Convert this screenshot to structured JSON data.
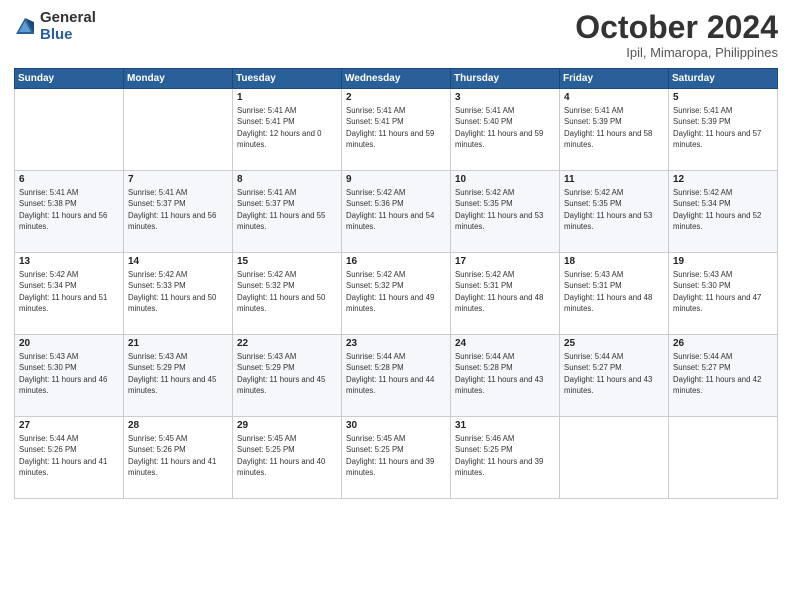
{
  "header": {
    "logo_general": "General",
    "logo_blue": "Blue",
    "title": "October 2024",
    "location": "Ipil, Mimaropa, Philippines"
  },
  "weekdays": [
    "Sunday",
    "Monday",
    "Tuesday",
    "Wednesday",
    "Thursday",
    "Friday",
    "Saturday"
  ],
  "weeks": [
    [
      {
        "day": "",
        "sunrise": "",
        "sunset": "",
        "daylight": ""
      },
      {
        "day": "",
        "sunrise": "",
        "sunset": "",
        "daylight": ""
      },
      {
        "day": "1",
        "sunrise": "Sunrise: 5:41 AM",
        "sunset": "Sunset: 5:41 PM",
        "daylight": "Daylight: 12 hours and 0 minutes."
      },
      {
        "day": "2",
        "sunrise": "Sunrise: 5:41 AM",
        "sunset": "Sunset: 5:41 PM",
        "daylight": "Daylight: 11 hours and 59 minutes."
      },
      {
        "day": "3",
        "sunrise": "Sunrise: 5:41 AM",
        "sunset": "Sunset: 5:40 PM",
        "daylight": "Daylight: 11 hours and 59 minutes."
      },
      {
        "day": "4",
        "sunrise": "Sunrise: 5:41 AM",
        "sunset": "Sunset: 5:39 PM",
        "daylight": "Daylight: 11 hours and 58 minutes."
      },
      {
        "day": "5",
        "sunrise": "Sunrise: 5:41 AM",
        "sunset": "Sunset: 5:39 PM",
        "daylight": "Daylight: 11 hours and 57 minutes."
      }
    ],
    [
      {
        "day": "6",
        "sunrise": "Sunrise: 5:41 AM",
        "sunset": "Sunset: 5:38 PM",
        "daylight": "Daylight: 11 hours and 56 minutes."
      },
      {
        "day": "7",
        "sunrise": "Sunrise: 5:41 AM",
        "sunset": "Sunset: 5:37 PM",
        "daylight": "Daylight: 11 hours and 56 minutes."
      },
      {
        "day": "8",
        "sunrise": "Sunrise: 5:41 AM",
        "sunset": "Sunset: 5:37 PM",
        "daylight": "Daylight: 11 hours and 55 minutes."
      },
      {
        "day": "9",
        "sunrise": "Sunrise: 5:42 AM",
        "sunset": "Sunset: 5:36 PM",
        "daylight": "Daylight: 11 hours and 54 minutes."
      },
      {
        "day": "10",
        "sunrise": "Sunrise: 5:42 AM",
        "sunset": "Sunset: 5:35 PM",
        "daylight": "Daylight: 11 hours and 53 minutes."
      },
      {
        "day": "11",
        "sunrise": "Sunrise: 5:42 AM",
        "sunset": "Sunset: 5:35 PM",
        "daylight": "Daylight: 11 hours and 53 minutes."
      },
      {
        "day": "12",
        "sunrise": "Sunrise: 5:42 AM",
        "sunset": "Sunset: 5:34 PM",
        "daylight": "Daylight: 11 hours and 52 minutes."
      }
    ],
    [
      {
        "day": "13",
        "sunrise": "Sunrise: 5:42 AM",
        "sunset": "Sunset: 5:34 PM",
        "daylight": "Daylight: 11 hours and 51 minutes."
      },
      {
        "day": "14",
        "sunrise": "Sunrise: 5:42 AM",
        "sunset": "Sunset: 5:33 PM",
        "daylight": "Daylight: 11 hours and 50 minutes."
      },
      {
        "day": "15",
        "sunrise": "Sunrise: 5:42 AM",
        "sunset": "Sunset: 5:32 PM",
        "daylight": "Daylight: 11 hours and 50 minutes."
      },
      {
        "day": "16",
        "sunrise": "Sunrise: 5:42 AM",
        "sunset": "Sunset: 5:32 PM",
        "daylight": "Daylight: 11 hours and 49 minutes."
      },
      {
        "day": "17",
        "sunrise": "Sunrise: 5:42 AM",
        "sunset": "Sunset: 5:31 PM",
        "daylight": "Daylight: 11 hours and 48 minutes."
      },
      {
        "day": "18",
        "sunrise": "Sunrise: 5:43 AM",
        "sunset": "Sunset: 5:31 PM",
        "daylight": "Daylight: 11 hours and 48 minutes."
      },
      {
        "day": "19",
        "sunrise": "Sunrise: 5:43 AM",
        "sunset": "Sunset: 5:30 PM",
        "daylight": "Daylight: 11 hours and 47 minutes."
      }
    ],
    [
      {
        "day": "20",
        "sunrise": "Sunrise: 5:43 AM",
        "sunset": "Sunset: 5:30 PM",
        "daylight": "Daylight: 11 hours and 46 minutes."
      },
      {
        "day": "21",
        "sunrise": "Sunrise: 5:43 AM",
        "sunset": "Sunset: 5:29 PM",
        "daylight": "Daylight: 11 hours and 45 minutes."
      },
      {
        "day": "22",
        "sunrise": "Sunrise: 5:43 AM",
        "sunset": "Sunset: 5:29 PM",
        "daylight": "Daylight: 11 hours and 45 minutes."
      },
      {
        "day": "23",
        "sunrise": "Sunrise: 5:44 AM",
        "sunset": "Sunset: 5:28 PM",
        "daylight": "Daylight: 11 hours and 44 minutes."
      },
      {
        "day": "24",
        "sunrise": "Sunrise: 5:44 AM",
        "sunset": "Sunset: 5:28 PM",
        "daylight": "Daylight: 11 hours and 43 minutes."
      },
      {
        "day": "25",
        "sunrise": "Sunrise: 5:44 AM",
        "sunset": "Sunset: 5:27 PM",
        "daylight": "Daylight: 11 hours and 43 minutes."
      },
      {
        "day": "26",
        "sunrise": "Sunrise: 5:44 AM",
        "sunset": "Sunset: 5:27 PM",
        "daylight": "Daylight: 11 hours and 42 minutes."
      }
    ],
    [
      {
        "day": "27",
        "sunrise": "Sunrise: 5:44 AM",
        "sunset": "Sunset: 5:26 PM",
        "daylight": "Daylight: 11 hours and 41 minutes."
      },
      {
        "day": "28",
        "sunrise": "Sunrise: 5:45 AM",
        "sunset": "Sunset: 5:26 PM",
        "daylight": "Daylight: 11 hours and 41 minutes."
      },
      {
        "day": "29",
        "sunrise": "Sunrise: 5:45 AM",
        "sunset": "Sunset: 5:25 PM",
        "daylight": "Daylight: 11 hours and 40 minutes."
      },
      {
        "day": "30",
        "sunrise": "Sunrise: 5:45 AM",
        "sunset": "Sunset: 5:25 PM",
        "daylight": "Daylight: 11 hours and 39 minutes."
      },
      {
        "day": "31",
        "sunrise": "Sunrise: 5:46 AM",
        "sunset": "Sunset: 5:25 PM",
        "daylight": "Daylight: 11 hours and 39 minutes."
      },
      {
        "day": "",
        "sunrise": "",
        "sunset": "",
        "daylight": ""
      },
      {
        "day": "",
        "sunrise": "",
        "sunset": "",
        "daylight": ""
      }
    ]
  ]
}
